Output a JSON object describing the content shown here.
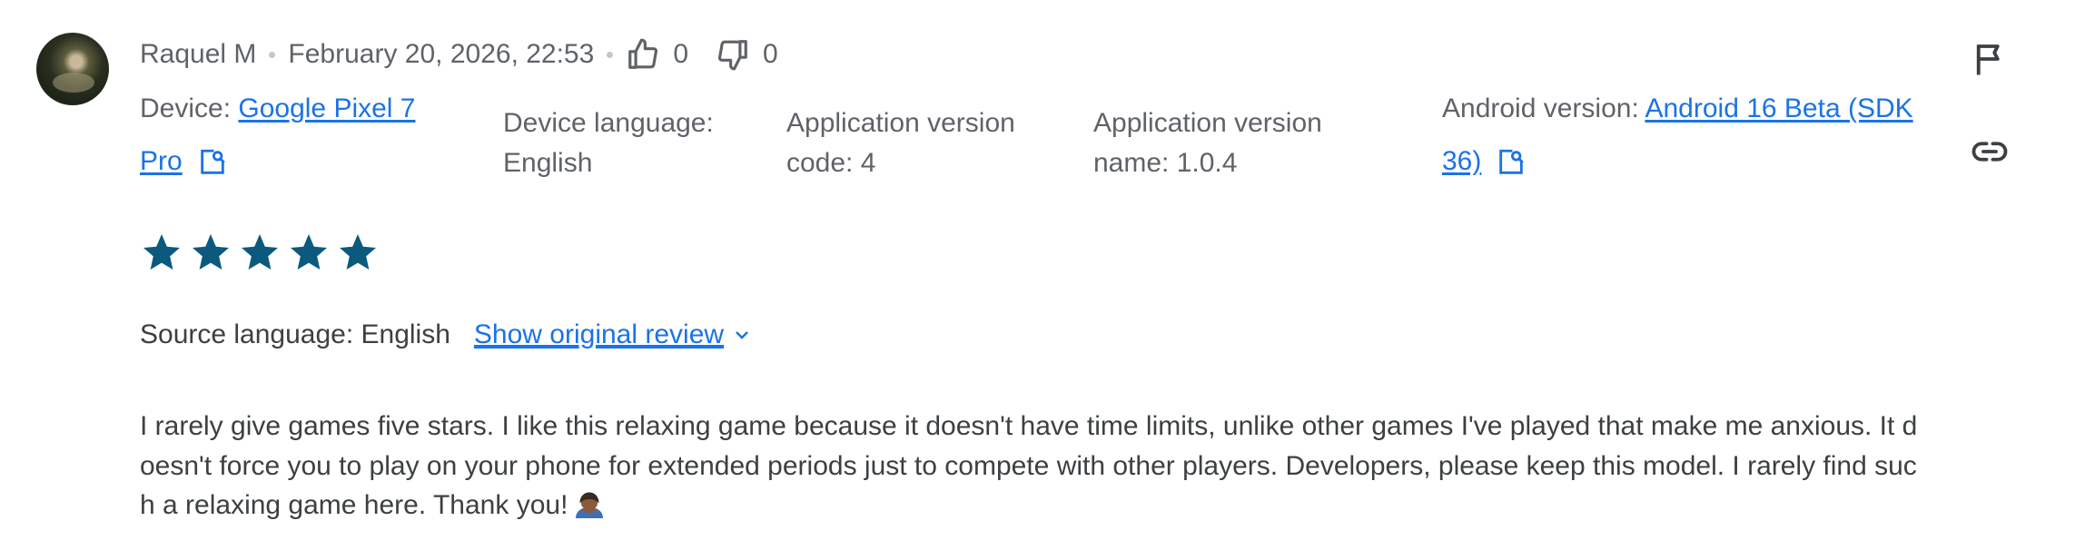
{
  "review": {
    "author": "Raquel M",
    "date": "February 20, 2026, 22:53",
    "thumbs_up_count": "0",
    "thumbs_down_count": "0",
    "rating": 5,
    "rating_max": 5,
    "text": "I rarely give games five stars. I like this relaxing game because it doesn't have time limits, unlike other games I've played that make me anxious. It doesn't force you to play on your phone for extended periods just to compete with other players. Developers, please keep this model. I rarely find such a relaxing game here. Thank you!"
  },
  "device": {
    "label": "Device: ",
    "value_line1": "Google Pixel 7",
    "value_line2": "Pro"
  },
  "device_language": {
    "label": "Device language:",
    "value": "English"
  },
  "app_version_code": {
    "label": "Application version",
    "value": "code: 4"
  },
  "app_version_name": {
    "label": "Application version",
    "value": "name: 1.0.4"
  },
  "android_version": {
    "label": "Android version: ",
    "value_line1": "Android 16 Beta (SDK",
    "value_line2": "36)"
  },
  "translation": {
    "source_label": "Source language: English",
    "show_original": "Show original review"
  },
  "icons": {
    "flag": "flag-icon",
    "link": "link-icon",
    "open_external": "open-in-new-icon",
    "thumbs_up": "thumbs-up-icon",
    "thumbs_down": "thumbs-down-icon",
    "star": "star-icon",
    "emoji": "person-bowing-emoji"
  },
  "colors": {
    "star": "#0b5a7e",
    "link": "#1a73e8",
    "meta_text": "#5f6368",
    "body_text": "#3c4043"
  }
}
